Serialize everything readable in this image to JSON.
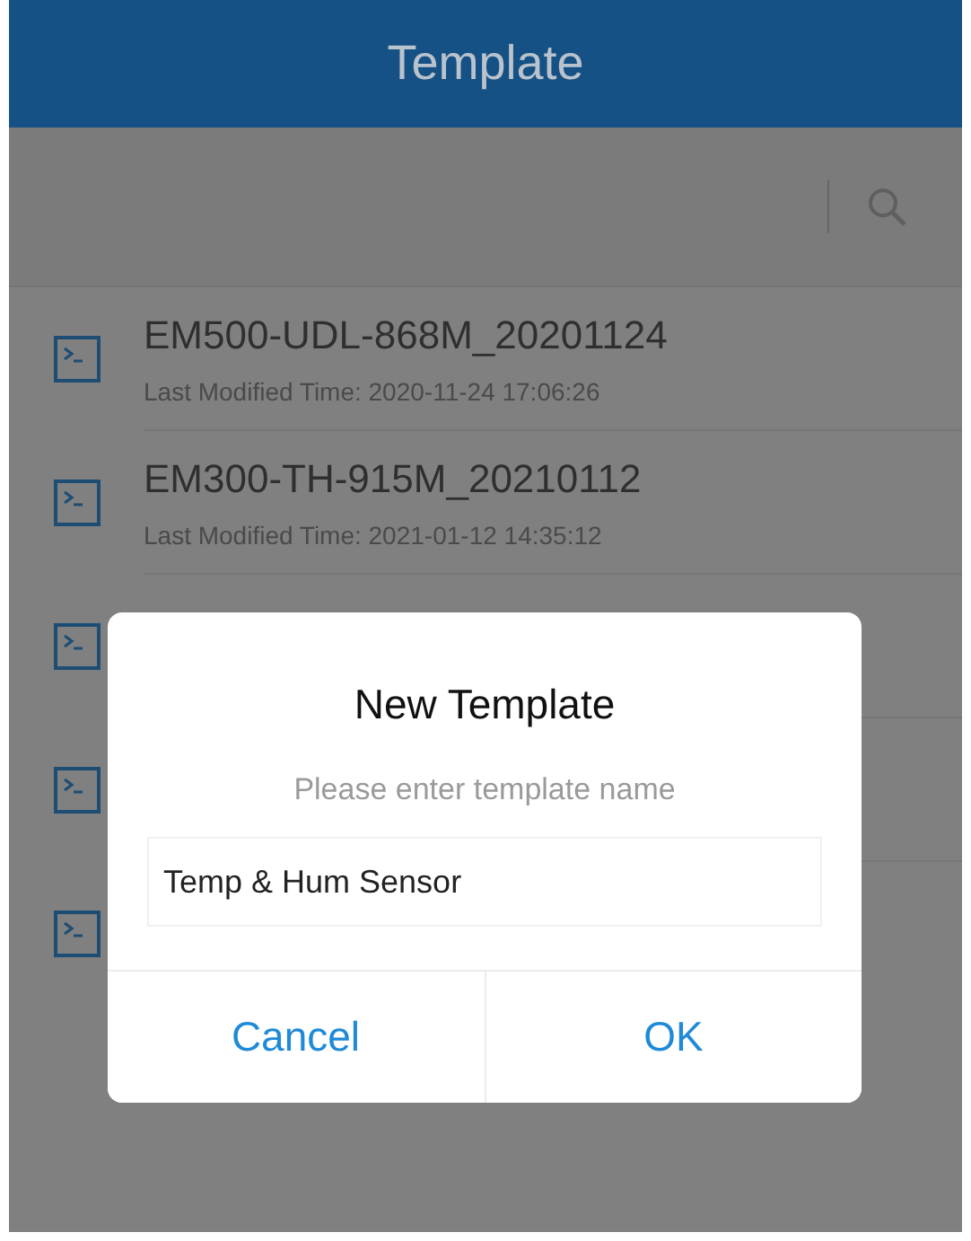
{
  "header": {
    "title": "Template"
  },
  "templates": [
    {
      "kind": "shown",
      "name": "EM500-UDL-868M_20201124",
      "time": "Last Modified Time: 2020-11-24 17:06:26"
    },
    {
      "kind": "shown",
      "name": "EM300-TH-915M_20210112",
      "time": "Last Modified Time: 2021-01-12 14:35:12"
    },
    {
      "kind": "covered"
    },
    {
      "kind": "covered"
    },
    {
      "kind": "covered"
    }
  ],
  "dialog": {
    "title": "New Template",
    "hint": "Please enter template name",
    "value": "Temp & Hum Sensor",
    "buttons": [
      "Cancel",
      "OK"
    ]
  }
}
